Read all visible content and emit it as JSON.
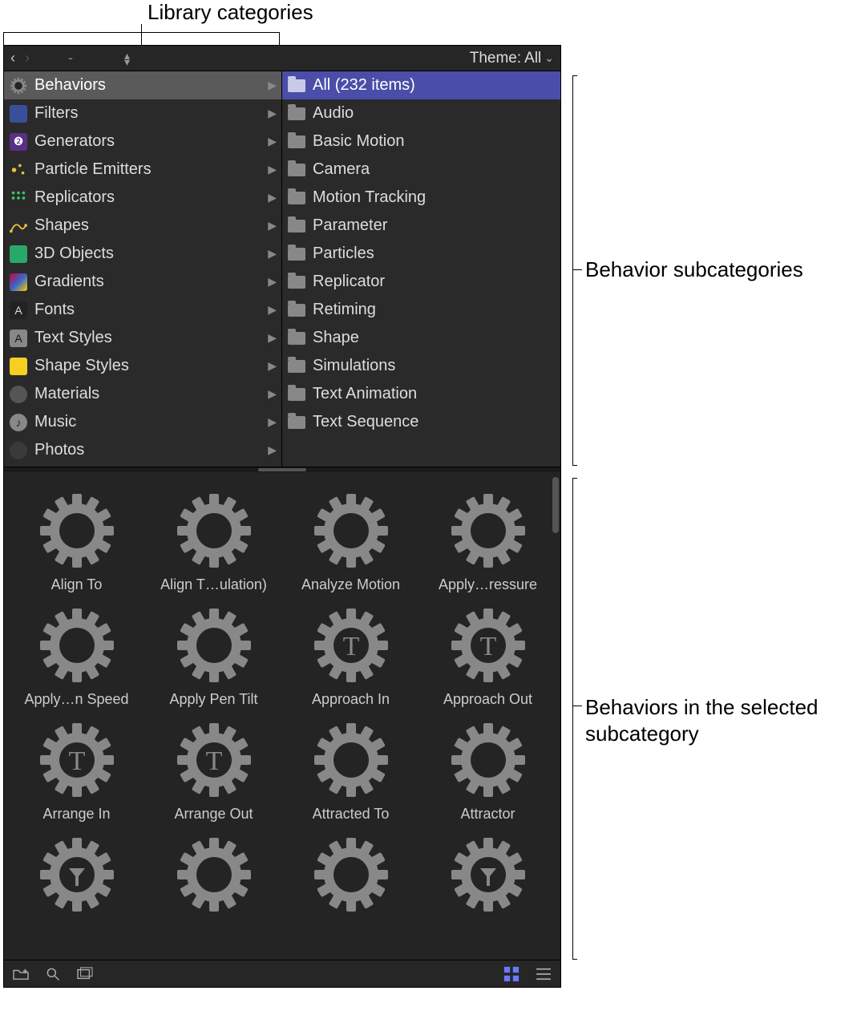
{
  "annotations": {
    "top": "Library categories",
    "right_upper": "Behavior subcategories",
    "right_lower": "Behaviors in the selected subcategory"
  },
  "toolbar": {
    "path_display": "-",
    "theme_label": "Theme:",
    "theme_value": "All"
  },
  "categories": [
    {
      "label": "Behaviors",
      "icon": "gear",
      "selected": true
    },
    {
      "label": "Filters",
      "icon": "filters"
    },
    {
      "label": "Generators",
      "icon": "gen"
    },
    {
      "label": "Particle Emitters",
      "icon": "part"
    },
    {
      "label": "Replicators",
      "icon": "rep"
    },
    {
      "label": "Shapes",
      "icon": "shape"
    },
    {
      "label": "3D Objects",
      "icon": "3d"
    },
    {
      "label": "Gradients",
      "icon": "grad"
    },
    {
      "label": "Fonts",
      "icon": "font"
    },
    {
      "label": "Text Styles",
      "icon": "txt"
    },
    {
      "label": "Shape Styles",
      "icon": "shapestyle"
    },
    {
      "label": "Materials",
      "icon": "mat"
    },
    {
      "label": "Music",
      "icon": "music"
    },
    {
      "label": "Photos",
      "icon": "photos"
    }
  ],
  "subcategories": [
    {
      "label": "All (232 items)",
      "selected": true
    },
    {
      "label": "Audio"
    },
    {
      "label": "Basic Motion"
    },
    {
      "label": "Camera"
    },
    {
      "label": "Motion Tracking"
    },
    {
      "label": "Parameter"
    },
    {
      "label": "Particles"
    },
    {
      "label": "Replicator"
    },
    {
      "label": "Retiming"
    },
    {
      "label": "Shape"
    },
    {
      "label": "Simulations"
    },
    {
      "label": "Text Animation"
    },
    {
      "label": "Text Sequence"
    }
  ],
  "grid_items": [
    {
      "label": "Align To",
      "variant": "gear"
    },
    {
      "label": "Align T…ulation)",
      "variant": "gear"
    },
    {
      "label": "Analyze Motion",
      "variant": "gear"
    },
    {
      "label": "Apply…ressure",
      "variant": "gear"
    },
    {
      "label": "Apply…n Speed",
      "variant": "gear"
    },
    {
      "label": "Apply Pen Tilt",
      "variant": "gear"
    },
    {
      "label": "Approach In",
      "variant": "gearT"
    },
    {
      "label": "Approach Out",
      "variant": "gearT"
    },
    {
      "label": "Arrange In",
      "variant": "gearT"
    },
    {
      "label": "Arrange Out",
      "variant": "gearT"
    },
    {
      "label": "Attracted To",
      "variant": "gear"
    },
    {
      "label": "Attractor",
      "variant": "gear"
    },
    {
      "label": "",
      "variant": "gearF"
    },
    {
      "label": "",
      "variant": "gear"
    },
    {
      "label": "",
      "variant": "gear"
    },
    {
      "label": "",
      "variant": "gearF"
    }
  ]
}
